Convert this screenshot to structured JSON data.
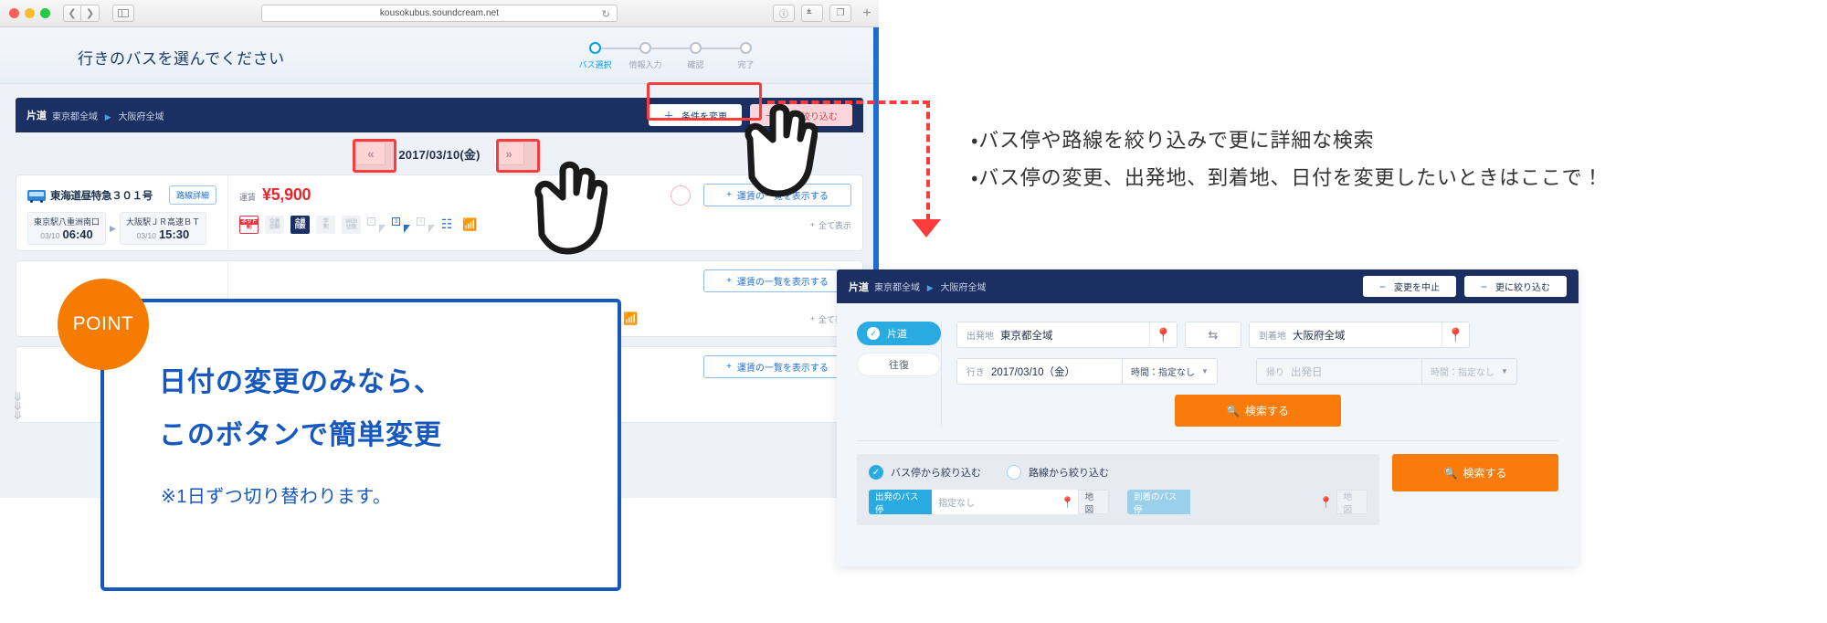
{
  "browser": {
    "url": "kousokubus.soundcream.net",
    "reload_icon": "reload-icon",
    "back_icon": "chevron-left-icon",
    "forward_icon": "chevron-right-icon",
    "sidebar_icon": "sidebar-icon",
    "info_icon": "info-icon",
    "share_icon": "share-icon",
    "tabs_icon": "tabs-icon",
    "newtab_icon": "plus-icon"
  },
  "page": {
    "title": "行きのバスを選んでください",
    "steps": [
      {
        "label": "バス選択",
        "active": true
      },
      {
        "label": "情報入力",
        "active": false
      },
      {
        "label": "確認",
        "active": false
      },
      {
        "label": "完了",
        "active": false
      }
    ]
  },
  "condition_bar": {
    "way": "片道",
    "origin": "東京都全域",
    "arrow": "▶",
    "destination": "大阪府全域",
    "change_conditions": "条件を変更",
    "narrow_more": "更に絞り込む",
    "plus": "＋"
  },
  "date_nav": {
    "prev": "《",
    "prev_glyph": "＜＜",
    "next_glyph": "＞＞",
    "date": "2017/03/10(金)"
  },
  "bus_card": {
    "bus_icon": "bus-icon",
    "name": "東海道昼特急３０１号",
    "route_detail": "路線詳細",
    "origin_stop": "東京駅八重洲南口",
    "origin_date": "03/10",
    "origin_time": "06:40",
    "dest_stop": "大阪駅ＪＲ高速ＢＴ",
    "dest_date": "03/10",
    "dest_time": "15:30",
    "fare_label": "運賃",
    "fare_value": "¥5,900",
    "fare_list_btn": "運賃の一覧を表示する",
    "show_all": "全て表示",
    "badges": [
      {
        "top": "ネット",
        "bottom": "割",
        "style": "net"
      },
      {
        "top": "会員",
        "bottom": "金額",
        "style": "off"
      },
      {
        "top": "会員",
        "bottom": "回数",
        "style": "navy"
      },
      {
        "top": "学",
        "bottom": "割",
        "style": "off"
      },
      {
        "top": "WEB",
        "bottom": "往復",
        "style": "off"
      }
    ],
    "seat_icons": [
      {
        "num": "2",
        "state": "off"
      },
      {
        "num": "3",
        "state": "on"
      },
      {
        "num": "4",
        "state": "off"
      }
    ],
    "amenity_icons": [
      "power-outlet-icon",
      "wifi-icon"
    ]
  },
  "callout": {
    "badge": "POINT",
    "line1": "日付の変更のみなら、",
    "line2": "このボタンで簡単変更",
    "note": "※1日ずつ切り替わります。"
  },
  "annotation": {
    "line1": "・バス停や路線を絞り込みで更に詳細な検索",
    "line2": "・バス停の変更、出発地、到着地、日付を変更したいときはここで！"
  },
  "search_panel": {
    "header": {
      "way": "片道",
      "origin": "東京都全域",
      "arrow": "▶",
      "destination": "大阪府全域",
      "cancel_change": "変更を中止",
      "narrow_more": "更に絞り込む",
      "minus": "−"
    },
    "way_tabs": [
      {
        "label": "片道",
        "selected": true
      },
      {
        "label": "往復",
        "selected": false
      }
    ],
    "origin_field": {
      "label": "出発地",
      "value": "東京都全域",
      "pin_icon": "map-pin-icon"
    },
    "swap_icon": "swap-arrows-icon",
    "dest_field": {
      "label": "到着地",
      "value": "大阪府全域",
      "pin_icon": "map-pin-icon"
    },
    "outbound": {
      "label": "行き",
      "value": "2017/03/10（金）"
    },
    "outbound_time": {
      "value": "時間：指定なし",
      "caret": "▼"
    },
    "return": {
      "label": "帰り",
      "placeholder": "出発日"
    },
    "return_time": {
      "value": "時間：指定なし",
      "caret": "▼"
    },
    "search_button": "検索する",
    "search_icon": "search-icon",
    "filters": {
      "by_stop": {
        "label": "バス停から絞り込む",
        "selected": true
      },
      "by_route": {
        "label": "路線から絞り込む",
        "selected": false
      },
      "departure_stop": {
        "label": "出発のバス停",
        "value": "指定なし",
        "map": "地図",
        "pin_icon": "map-pin-icon"
      },
      "arrival_stop": {
        "label": "到着のバス停",
        "value": "",
        "map": "地図",
        "pin_icon": "map-pin-icon"
      }
    },
    "search_button2": "検索する"
  },
  "colors": {
    "navy": "#1b2f63",
    "accent_blue": "#29abe2",
    "orange": "#f97c0a",
    "point_orange": "#f57c00",
    "callout_blue": "#1558c0",
    "red_highlight": "#fc3b3b",
    "fare_red": "#e8262f"
  }
}
